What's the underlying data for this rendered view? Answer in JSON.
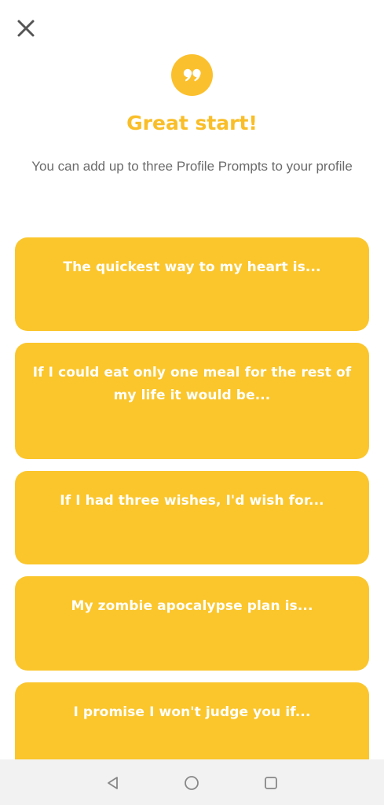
{
  "header": {
    "close_icon": "close-icon",
    "badge_icon": "quote-icon",
    "title": "Great start!",
    "subtitle": "You can add up to three Profile Prompts to your profile"
  },
  "prompts": [
    {
      "label": "The quickest way to my heart is..."
    },
    {
      "label": "If I could eat only one meal for the rest of my life it would be..."
    },
    {
      "label": "If I had three wishes, I'd wish for..."
    },
    {
      "label": "My zombie apocalypse plan is..."
    },
    {
      "label": "I promise I won't judge you if..."
    }
  ],
  "navigation": {
    "back_icon": "back-triangle-icon",
    "home_icon": "home-circle-icon",
    "recents_icon": "recents-square-icon"
  },
  "colors": {
    "accent": "#FBC62C",
    "title": "#F9BE28",
    "subtitle": "#6b6b6b",
    "nav_background": "#f2f2f2"
  }
}
